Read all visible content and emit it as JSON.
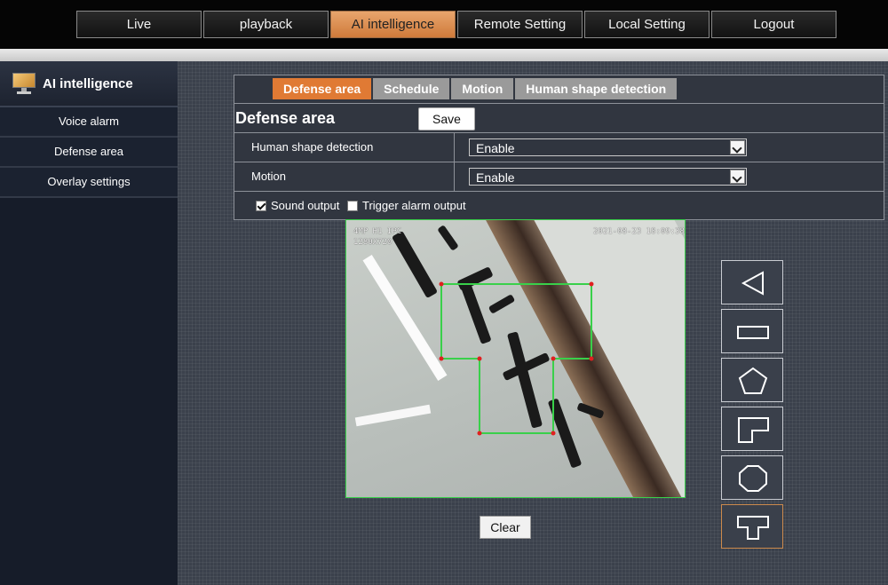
{
  "nav": {
    "items": [
      {
        "label": "Live"
      },
      {
        "label": "playback"
      },
      {
        "label": "AI intelligence",
        "active": true
      },
      {
        "label": "Remote Setting"
      },
      {
        "label": "Local Setting"
      },
      {
        "label": "Logout"
      }
    ]
  },
  "sidebar": {
    "title": "AI intelligence",
    "icon": "monitor-icon",
    "items": [
      {
        "label": "Voice alarm"
      },
      {
        "label": "Defense area"
      },
      {
        "label": "Overlay settings"
      }
    ]
  },
  "tabs": [
    {
      "label": "Defense area",
      "active": true
    },
    {
      "label": "Schedule"
    },
    {
      "label": "Motion"
    },
    {
      "label": "Human shape detection"
    }
  ],
  "section": {
    "title": "Defense area",
    "save_label": "Save"
  },
  "form": {
    "human_label": "Human shape detection",
    "human_value": "Enable",
    "motion_label": "Motion",
    "motion_value": "Enable",
    "sound_output_label": "Sound output",
    "sound_output_checked": true,
    "trigger_alarm_label": "Trigger alarm output",
    "trigger_alarm_checked": false
  },
  "video": {
    "overlay_line1": "4MP H1 IPC",
    "overlay_line2": "1280X720",
    "timestamp": "2021-08-23 18:09:38"
  },
  "shapes": [
    {
      "icon": "triangle-shape-icon"
    },
    {
      "icon": "rectangle-shape-icon"
    },
    {
      "icon": "pentagon-shape-icon"
    },
    {
      "icon": "l-shape-icon"
    },
    {
      "icon": "octagon-shape-icon"
    },
    {
      "icon": "t-shape-icon",
      "selected": true
    }
  ],
  "clear_label": "Clear",
  "colors": {
    "accent": "#e07a34",
    "zone_line": "#39d04a",
    "zone_vertex": "#e02020"
  }
}
